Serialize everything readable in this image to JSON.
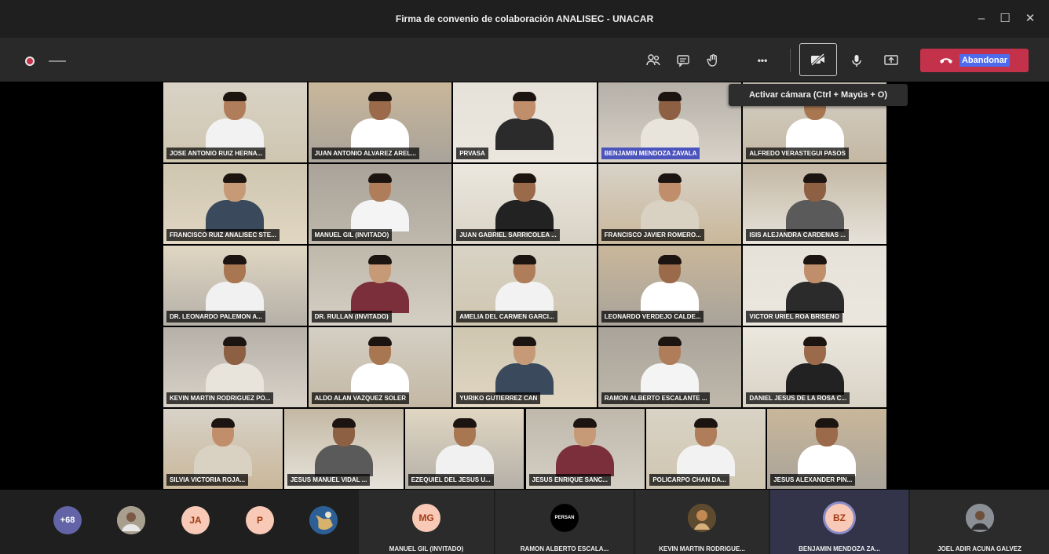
{
  "window": {
    "title": "Firma de convenio de colaboración ANALISEC - UNACAR",
    "controls": {
      "minimize": "–",
      "maximize": "☐",
      "close": "✕"
    }
  },
  "toolbar": {
    "recording": true,
    "icons": [
      "participants-icon",
      "chat-icon",
      "raise-hand-icon",
      "more-actions-icon",
      "camera-off-icon",
      "microphone-icon",
      "share-screen-icon"
    ],
    "more_label": "•••",
    "leave_label": "Abandonar",
    "camera_tooltip": "Activar cámara (Ctrl + Mayús + O)"
  },
  "grid": {
    "rows": [
      [
        "JOSE ANTONIO RUIZ HERNA...",
        "JUAN ANTONIO ALVAREZ AREL...",
        "prvasa",
        "BENJAMIN MENDOZA ZAVALA",
        "ALFREDO VERASTEGUI PASOS"
      ],
      [
        "Francisco Ruiz ANALISEC STE...",
        "MANUEL GIL (Invitado)",
        "JUAN GABRIEL SARRICOLEA ...",
        "FRANCISCO JAVIER ROMERO...",
        "ISIS ALEJANDRA CARDENAS ..."
      ],
      [
        "DR. LEONARDO PALEMON A...",
        "Dr. Rullan (Invitado)",
        "AMELIA DEL CARMEN GARCI...",
        "LEONARDO VERDEJO CALDE...",
        "VICTOR URIEL ROA BRISENO"
      ],
      [
        "KEVIN MARTIN RODRIGUEZ PO...",
        "ALDO ALAN VAZQUEZ SOLER",
        "YURIKO GUTIERREZ CAN",
        "RAMON ALBERTO ESCALANTE ...",
        "DANIEL JESUS DE LA ROSA C..."
      ],
      [
        "SILVIA VICTORIA ROJA...",
        "JESUS MANUEL VIDAL ...",
        "EZEQUIEL DEL JESUS U...",
        "JESUS ENRIQUE SANC...",
        "POLICARPO CHAN DA...",
        "JESUS ALEXANDER PIN..."
      ]
    ],
    "highlighted": "BENJAMIN MENDOZA ZAVALA"
  },
  "strip": {
    "overflow_count": "+68",
    "avatars": [
      "",
      "JA",
      "P",
      ""
    ],
    "tiles": [
      {
        "initials": "MG",
        "name": "MANUEL GIL (Invitado)"
      },
      {
        "initials": "PERSAN",
        "name": "RAMON ALBERTO ESCALA..."
      },
      {
        "initials": "",
        "name": "KEVIN MARTIN RODRIGUE..."
      },
      {
        "initials": "BZ",
        "name": "BENJAMIN MENDOZA ZA..."
      },
      {
        "initials": "",
        "name": "JOEL ADIR ACUNA GALVEZ"
      }
    ]
  },
  "colors": {
    "leave": "#c4314b",
    "accent": "#4f6bed"
  }
}
